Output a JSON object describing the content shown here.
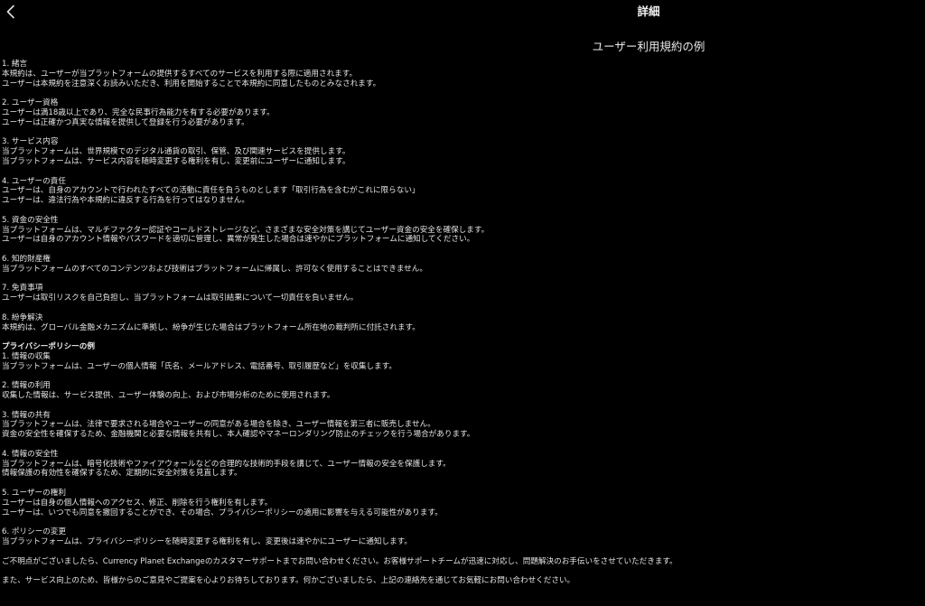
{
  "header": {
    "title": "詳細",
    "back_icon": "chevron-left-icon"
  },
  "doc_title": "ユーザー利用規約の例",
  "terms": [
    {
      "heading": "1. 緒言",
      "lines": [
        "本規約は、ユーザーが当プラットフォームの提供するすべてのサービスを利用する際に適用されます。",
        "ユーザーは本規約を注意深くお読みいただき、利用を開始することで本規約に同意したものとみなされます。"
      ]
    },
    {
      "heading": "2. ユーザー資格",
      "lines": [
        "ユーザーは満18歳以上であり、完全な民事行為能力を有する必要があります。",
        "ユーザーは正確かつ真実な情報を提供して登録を行う必要があります。"
      ]
    },
    {
      "heading": "3. サービス内容",
      "lines": [
        "当プラットフォームは、世界規模でのデジタル通貨の取引、保管、及び関連サービスを提供します。",
        "当プラットフォームは、サービス内容を随時変更する権利を有し、変更前にユーザーに通知します。"
      ]
    },
    {
      "heading": "4. ユーザーの責任",
      "lines": [
        "ユーザーは、自身のアカウントで行われたすべての活動に責任を負うものとします「取引行為を含むがこれに限らない」",
        "ユーザーは、違法行為や本規約に違反する行為を行ってはなりません。"
      ]
    },
    {
      "heading": "5. 資金の安全性",
      "lines": [
        "当プラットフォームは、マルチファクター認証やコールドストレージなど、さまざまな安全対策を講じてユーザー資金の安全を確保します。",
        "ユーザーは自身のアカウント情報やパスワードを適切に管理し、異常が発生した場合は速やかにプラットフォームに通知してください。"
      ]
    },
    {
      "heading": "6. 知的財産権",
      "lines": [
        "当プラットフォームのすべてのコンテンツおよび技術はプラットフォームに帰属し、許可なく使用することはできません。"
      ]
    },
    {
      "heading": "7. 免責事項",
      "lines": [
        "ユーザーは取引リスクを自己負担し、当プラットフォームは取引結果について一切責任を負いません。"
      ]
    },
    {
      "heading": "8. 紛争解決",
      "lines": [
        "本規約は、グローバル金融メカニズムに準拠し、紛争が生じた場合はプラットフォーム所在地の裁判所に付託されます。"
      ]
    }
  ],
  "privacy_title": "プライバシーポリシーの例",
  "privacy": [
    {
      "heading": "1. 情報の収集",
      "lines": [
        "当プラットフォームは、ユーザーの個人情報「氏名、メールアドレス、電話番号、取引履歴など」を収集します。"
      ]
    },
    {
      "heading": "2. 情報の利用",
      "lines": [
        "収集した情報は、サービス提供、ユーザー体験の向上、および市場分析のために使用されます。"
      ]
    },
    {
      "heading": "3. 情報の共有",
      "lines": [
        "当プラットフォームは、法律で要求される場合やユーザーの同意がある場合を除き、ユーザー情報を第三者に販売しません。",
        "資金の安全性を確保するため、金融機関と必要な情報を共有し、本人確認やマネーロンダリング防止のチェックを行う場合があります。"
      ]
    },
    {
      "heading": "4. 情報の安全性",
      "lines": [
        "当プラットフォームは、暗号化技術やファイアウォールなどの合理的な技術的手段を講じて、ユーザー情報の安全を保護します。",
        "情報保護の有効性を確保するため、定期的に安全対策を見直します。"
      ]
    },
    {
      "heading": "5. ユーザーの権利",
      "lines": [
        "ユーザーは自身の個人情報へのアクセス、修正、削除を行う権利を有します。",
        "ユーザーは、いつでも同意を撤回することができ、その場合、プライバシーポリシーの適用に影響を与える可能性があります。"
      ]
    },
    {
      "heading": "6. ポリシーの変更",
      "lines": [
        "当プラットフォームは、プライバシーポリシーを随時変更する権利を有し、変更後は速やかにユーザーに通知します。"
      ]
    }
  ],
  "notes": [
    "ご不明点がございましたら、Currency Planet Exchangeのカスタマーサポートまでお問い合わせください。お客様サポートチームが迅速に対応し、問題解決のお手伝いをさせていただきます。",
    "また、サービス向上のため、皆様からのご意見やご提案を心よりお待ちしております。何かございましたら、上記の連絡先を通じてお気軽にお問い合わせください。"
  ]
}
